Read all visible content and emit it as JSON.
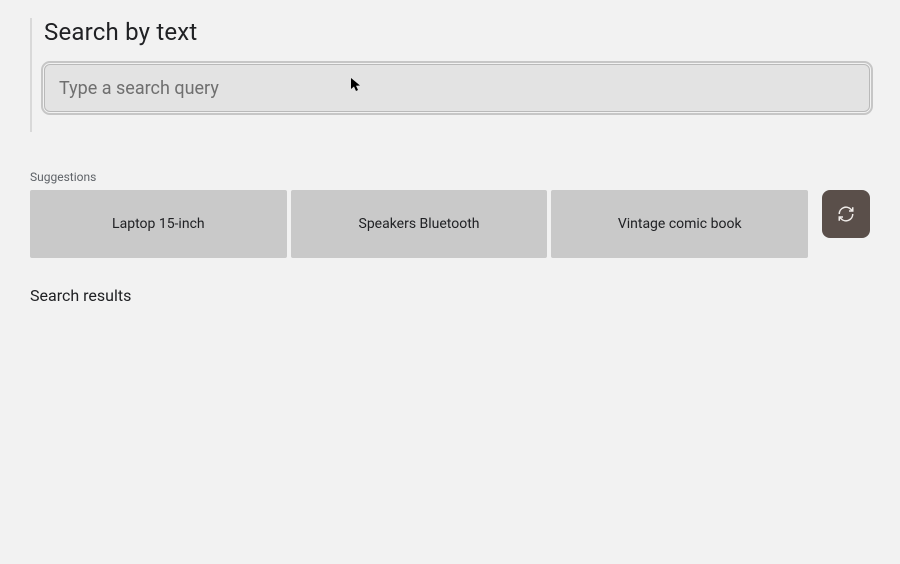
{
  "header": {
    "title": "Search by text"
  },
  "search": {
    "value": "",
    "placeholder": "Type a search query"
  },
  "suggestions": {
    "label": "Suggestions",
    "items": [
      {
        "label": "Laptop 15-inch"
      },
      {
        "label": "Speakers Bluetooth"
      },
      {
        "label": "Vintage comic book"
      }
    ]
  },
  "results": {
    "title": "Search results"
  },
  "colors": {
    "page_bg": "#f2f2f2",
    "suggestion_bg": "#c9c9c9",
    "refresh_bg": "#5a4f4a",
    "input_bg": "#e3e3e3"
  }
}
